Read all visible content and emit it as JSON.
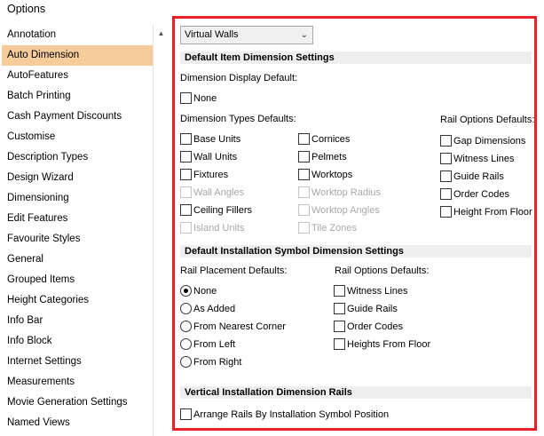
{
  "window": {
    "title": "Options"
  },
  "sidebar": {
    "items": [
      {
        "label": "Annotation",
        "selected": false
      },
      {
        "label": "Auto Dimension",
        "selected": true
      },
      {
        "label": "AutoFeatures",
        "selected": false
      },
      {
        "label": "Batch Printing",
        "selected": false
      },
      {
        "label": "Cash Payment Discounts",
        "selected": false
      },
      {
        "label": "Customise",
        "selected": false
      },
      {
        "label": "Description Types",
        "selected": false
      },
      {
        "label": "Design Wizard",
        "selected": false
      },
      {
        "label": "Dimensioning",
        "selected": false
      },
      {
        "label": "Edit Features",
        "selected": false
      },
      {
        "label": "Favourite Styles",
        "selected": false
      },
      {
        "label": "General",
        "selected": false
      },
      {
        "label": "Grouped Items",
        "selected": false
      },
      {
        "label": "Height Categories",
        "selected": false
      },
      {
        "label": "Info Bar",
        "selected": false
      },
      {
        "label": "Info Block",
        "selected": false
      },
      {
        "label": "Internet Settings",
        "selected": false
      },
      {
        "label": "Measurements",
        "selected": false
      },
      {
        "label": "Movie Generation Settings",
        "selected": false
      },
      {
        "label": "Named Views",
        "selected": false
      }
    ],
    "scroll_up_icon": "triangle-up"
  },
  "panel": {
    "dropdown": {
      "value": "Virtual Walls"
    },
    "default_item": {
      "header": "Default Item Dimension Settings",
      "display_default_label": "Dimension Display Default:",
      "display_none": "None",
      "types_label": "Dimension Types Defaults:",
      "types_col1": [
        {
          "label": "Base Units",
          "enabled": true
        },
        {
          "label": "Wall Units",
          "enabled": true
        },
        {
          "label": "Fixtures",
          "enabled": true
        },
        {
          "label": "Wall Angles",
          "enabled": false
        },
        {
          "label": "Ceiling Fillers",
          "enabled": true
        },
        {
          "label": "Island Units",
          "enabled": false
        }
      ],
      "types_col2": [
        {
          "label": "Cornices",
          "enabled": true
        },
        {
          "label": "Pelmets",
          "enabled": true
        },
        {
          "label": "Worktops",
          "enabled": true
        },
        {
          "label": "Worktop Radius",
          "enabled": false
        },
        {
          "label": "Worktop Angles",
          "enabled": false
        },
        {
          "label": "Tile Zones",
          "enabled": false
        }
      ],
      "rail_label": "Rail Options Defaults:",
      "rail_options": [
        "Gap Dimensions",
        "Witness Lines",
        "Guide Rails",
        "Order Codes",
        "Height From Floor"
      ]
    },
    "installation": {
      "header": "Default Installation Symbol Dimension Settings",
      "placement_label": "Rail Placement Defaults:",
      "placement_options": [
        {
          "label": "None",
          "selected": true
        },
        {
          "label": "As Added",
          "selected": false
        },
        {
          "label": "From Nearest Corner",
          "selected": false
        },
        {
          "label": "From Left",
          "selected": false
        },
        {
          "label": "From Right",
          "selected": false
        }
      ],
      "rail_label": "Rail Options Defaults:",
      "rail_options": [
        "Witness Lines",
        "Guide Rails",
        "Order Codes",
        "Heights From Floor"
      ]
    },
    "vertical": {
      "header": "Vertical Installation Dimension Rails",
      "arrange_label": "Arrange Rails By Installation Symbol Position"
    }
  },
  "colors": {
    "selected_bg": "#f6cc9a",
    "highlight_border": "#e8202a",
    "section_bg": "#eeeeee"
  }
}
